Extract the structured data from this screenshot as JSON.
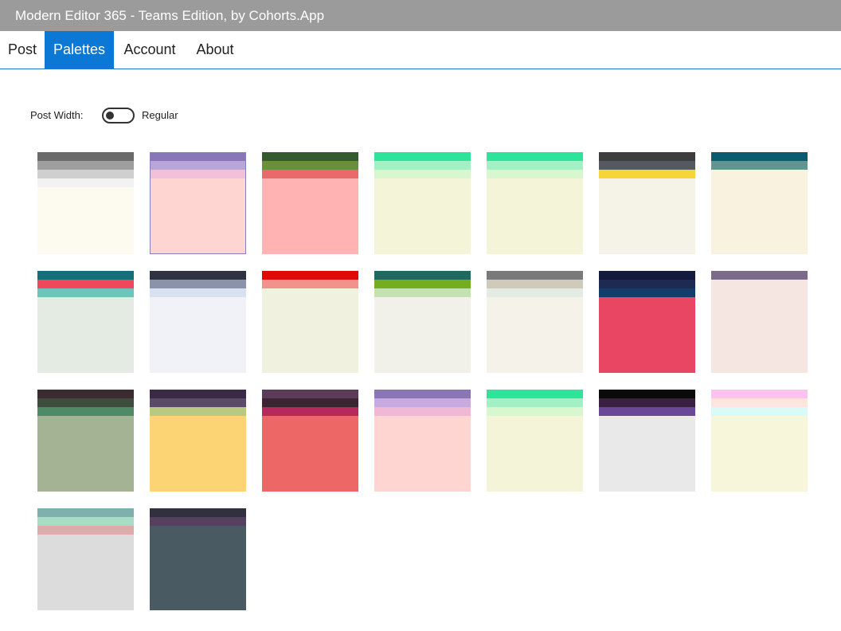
{
  "window": {
    "title": "Modern Editor 365 - Teams Edition, by Cohorts.App"
  },
  "tabs": [
    {
      "label": "Post"
    },
    {
      "label": "Palettes"
    },
    {
      "label": "Account"
    },
    {
      "label": "About"
    }
  ],
  "active_tab": "Palettes",
  "post_width": {
    "label": "Post Width:",
    "value": "Regular",
    "toggle_on": false
  },
  "palettes": [
    {
      "selected": false,
      "colors": [
        "#6a6a6a",
        "#9e9e9e",
        "#cfcfcf",
        "#f2f2f2",
        "#fdfaf0"
      ]
    },
    {
      "selected": true,
      "colors": [
        "#8876b6",
        "#b9a6d8",
        "#f0c1d8",
        "#ffd5d2"
      ]
    },
    {
      "selected": false,
      "colors": [
        "#335b2d",
        "#6b8e3a",
        "#e86a6a",
        "#ffb3b3"
      ]
    },
    {
      "selected": false,
      "colors": [
        "#2ee39a",
        "#a3f0c4",
        "#d8f7cf",
        "#f4f5d8"
      ]
    },
    {
      "selected": false,
      "colors": [
        "#2ee39a",
        "#a3f0c4",
        "#d8f7cf",
        "#f4f5d8"
      ]
    },
    {
      "selected": false,
      "colors": [
        "#3d3d3d",
        "#545a5f",
        "#f7d43a",
        "#f5f2e7"
      ]
    },
    {
      "selected": false,
      "colors": [
        "#0b5c6f",
        "#62958f",
        "#f9f2df"
      ]
    },
    {
      "selected": false,
      "colors": [
        "#136f79",
        "#f0475b",
        "#6dc4b8",
        "#e3ebe2"
      ]
    },
    {
      "selected": false,
      "colors": [
        "#2f3240",
        "#8a93a9",
        "#d8e1ef",
        "#f0f2f7"
      ]
    },
    {
      "selected": false,
      "colors": [
        "#dd0a05",
        "#f0938c",
        "#f0f1de"
      ]
    },
    {
      "selected": false,
      "colors": [
        "#1f6a5d",
        "#74ad20",
        "#c4e1b0",
        "#f1f1ea"
      ]
    },
    {
      "selected": false,
      "colors": [
        "#7a7a7a",
        "#d0cabb",
        "#e3ebe2",
        "#f5f2ea"
      ]
    },
    {
      "selected": false,
      "colors": [
        "#151b3c",
        "#1d2a52",
        "#113f6a",
        "#e84663"
      ]
    },
    {
      "selected": false,
      "colors": [
        "#7a6b8a",
        "#f5e6e2"
      ]
    },
    {
      "selected": false,
      "colors": [
        "#3c2a32",
        "#3f4d3e",
        "#4d8a65",
        "#a3b393"
      ]
    },
    {
      "selected": false,
      "colors": [
        "#3a2a45",
        "#5c4a6a",
        "#b8c981",
        "#fcd474"
      ]
    },
    {
      "selected": false,
      "colors": [
        "#5c3a5a",
        "#3c2433",
        "#b8285a",
        "#ec6765"
      ]
    },
    {
      "selected": false,
      "colors": [
        "#8a76b4",
        "#c7aadf",
        "#f0b8d4",
        "#ffd5d2"
      ]
    },
    {
      "selected": false,
      "colors": [
        "#2ee39a",
        "#a3f0c4",
        "#d8f7cf",
        "#f4f5d8"
      ]
    },
    {
      "selected": false,
      "colors": [
        "#0a0a0a",
        "#3a2040",
        "#6a4899",
        "#e9e9e9"
      ]
    },
    {
      "selected": false,
      "colors": [
        "#ffc2f0",
        "#ffe5dd",
        "#d8fbf9",
        "#f7f6da"
      ]
    },
    {
      "selected": false,
      "colors": [
        "#7eb0ad",
        "#a9dcc5",
        "#dfaaaa",
        "#dcdcdc"
      ]
    },
    {
      "selected": false,
      "colors": [
        "#30303e",
        "#57405f",
        "#4a5a62"
      ]
    }
  ]
}
